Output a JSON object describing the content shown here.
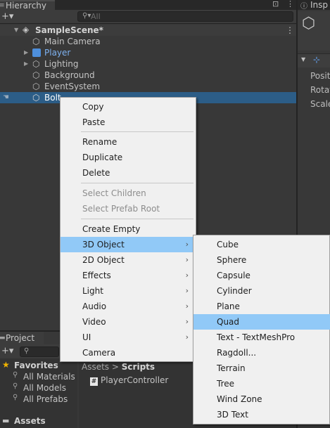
{
  "hierarchy": {
    "tab_label": "Hierarchy",
    "search_placeholder": "All",
    "scene": "SampleScene*",
    "objects": [
      "Main Camera",
      "Player",
      "Lighting",
      "Background",
      "EventSystem",
      "Bolt"
    ]
  },
  "inspector": {
    "tab_label": "Insp",
    "labels": [
      "Posit",
      "Rotat",
      "Scale"
    ]
  },
  "project": {
    "tab_label": "Project",
    "favorites_title": "Favorites",
    "favorites": [
      "All Materials",
      "All Models",
      "All Prefabs"
    ],
    "assets_title": "Assets",
    "breadcrumb_root": "Assets",
    "breadcrumb_sep": ">",
    "breadcrumb_folder": "Scripts",
    "asset_item": "PlayerController"
  },
  "context_menu": {
    "items": [
      "Copy",
      "Paste",
      "Rename",
      "Duplicate",
      "Delete",
      "Select Children",
      "Select Prefab Root",
      "Create Empty",
      "3D Object",
      "2D Object",
      "Effects",
      "Light",
      "Audio",
      "Video",
      "UI",
      "Camera"
    ],
    "highlighted": "3D Object"
  },
  "submenu_3d": {
    "items": [
      "Cube",
      "Sphere",
      "Capsule",
      "Cylinder",
      "Plane",
      "Quad",
      "Text - TextMeshPro",
      "Ragdoll...",
      "Terrain",
      "Tree",
      "Wind Zone",
      "3D Text"
    ],
    "highlighted": "Quad"
  },
  "colors": {
    "menu_highlight": "#91c9f7",
    "selection": "#2c5d87",
    "prefab_blue": "#7fb2f0"
  }
}
